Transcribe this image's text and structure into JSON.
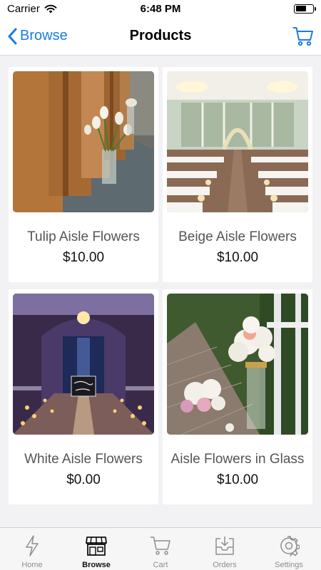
{
  "status_bar": {
    "carrier": "Carrier",
    "time": "6:48 PM"
  },
  "nav": {
    "back_label": "Browse",
    "title": "Products"
  },
  "products": [
    {
      "name": "Tulip Aisle Flowers",
      "price": "$10.00"
    },
    {
      "name": "Beige Aisle Flowers",
      "price": "$10.00"
    },
    {
      "name": "White Aisle Flowers",
      "price": "$0.00"
    },
    {
      "name": "Aisle Flowers in Glass",
      "price": "$10.00"
    }
  ],
  "tabs": [
    {
      "label": "Home",
      "icon": "bolt-icon",
      "active": false
    },
    {
      "label": "Browse",
      "icon": "storefront-icon",
      "active": true
    },
    {
      "label": "Cart",
      "icon": "cart-icon",
      "active": false
    },
    {
      "label": "Orders",
      "icon": "inbox-tray-icon",
      "active": false
    },
    {
      "label": "Settings",
      "icon": "gear-icon",
      "active": false
    }
  ],
  "colors": {
    "accent": "#1a7ce6",
    "tab_inactive": "#8e8e93",
    "tab_active": "#111111"
  }
}
